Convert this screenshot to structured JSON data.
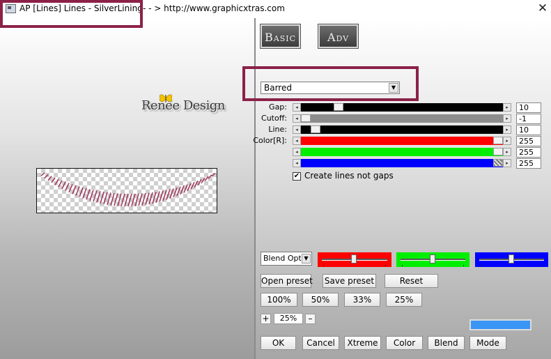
{
  "window": {
    "title": "AP [Lines]  Lines - SilverLining",
    "url": "- - > http://www.graphicxtras.com",
    "close_glyph": "✕"
  },
  "logo": {
    "text": "Renée Design"
  },
  "tabs": {
    "basic": "Basic",
    "adv": "Adv"
  },
  "mode_select": {
    "value": "Barred"
  },
  "sliders": [
    {
      "label": "Gap:",
      "value": "10",
      "fill": "#000000",
      "level": 0.17
    },
    {
      "label": "Cutoff:",
      "value": "-1",
      "fill": "#8c8c8c",
      "level": 0.0
    },
    {
      "label": "Line:",
      "value": "10",
      "fill": "#000000",
      "level": 0.05
    },
    {
      "label": "Color[R]:",
      "value": "255",
      "fill": "#ff0000",
      "level": 1.0
    },
    {
      "label": "",
      "value": "255",
      "fill": "#00ee00",
      "level": 1.0
    },
    {
      "label": "",
      "value": "255",
      "fill": "#0000ff",
      "level": 1.0
    }
  ],
  "checkbox": {
    "label": "Create lines not gaps",
    "checked": true,
    "mark": "✔"
  },
  "blend": {
    "value": "Blend Options"
  },
  "color_panels": {
    "red": "#ff0000",
    "green": "#00ee00",
    "blue": "#0000ff"
  },
  "buttons": {
    "open_preset": "Open preset",
    "save_preset": "Save preset",
    "reset": "Reset",
    "z100": "100%",
    "z50": "50%",
    "z33": "33%",
    "z25": "25%",
    "ok": "OK",
    "cancel": "Cancel",
    "xtreme": "Xtreme",
    "color": "Color",
    "blend": "Blend",
    "mode": "Mode"
  },
  "zoom": {
    "plus": "+",
    "value": "25%",
    "minus": "–"
  },
  "colors": {
    "highlight": "#8c2148",
    "accent_blue": "#3a95f5",
    "stripe": "#9e3a5e"
  }
}
